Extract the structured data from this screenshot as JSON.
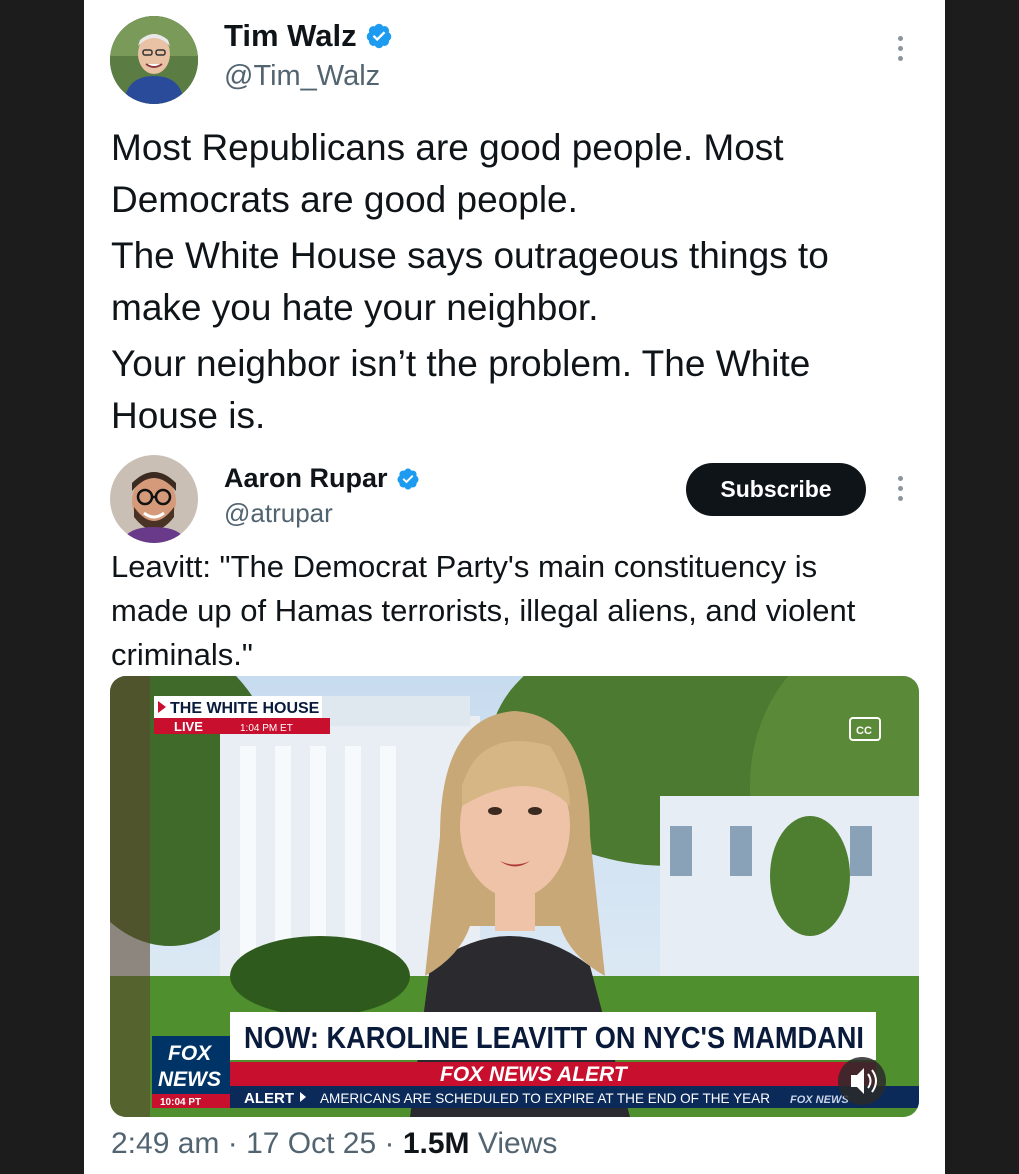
{
  "main_tweet": {
    "author_name": "Tim Walz",
    "author_handle": "@Tim_Walz",
    "paragraphs": [
      "Most Republicans are good people. Most Democrats are good people.",
      "The White House says outrageous things to make you hate your neighbor.",
      "Your neighbor isn’t the problem. The White House is."
    ]
  },
  "quoted_tweet": {
    "author_name": "Aaron Rupar",
    "author_handle": "@atrupar",
    "subscribe_label": "Subscribe",
    "text": "Leavitt: \"The Democrat Party's main constituency is made up of Hamas terrorists, illegal aliens, and violent criminals.\""
  },
  "video": {
    "location_tag": "THE WHITE HOUSE",
    "live_label": "LIVE",
    "live_time": "1:04 PM ET",
    "cc_label": "CC",
    "headline": "NOW: KAROLINE LEAVITT ON NYC'S MAMDANI",
    "alert_banner": "FOX NEWS ALERT",
    "logo_line1": "FOX",
    "logo_line2": "NEWS",
    "logo_time": "10:04 PT",
    "ticker_label": "ALERT",
    "ticker_text": "AMERICANS ARE SCHEDULED TO EXPIRE AT THE END OF THE YEAR",
    "ticker_logo": "FOX NEWS"
  },
  "footer": {
    "time": "2:49 am",
    "date": "17 Oct 25",
    "views_count": "1.5M",
    "views_label": "Views"
  },
  "colors": {
    "verified": "#1d9bf0",
    "text": "#0f1419",
    "muted": "#536471",
    "fox_red": "#c8102e",
    "fox_blue": "#003366"
  },
  "icons": [
    "verified-badge-icon",
    "more-options-icon",
    "closed-captions-icon",
    "speaker-icon"
  ]
}
